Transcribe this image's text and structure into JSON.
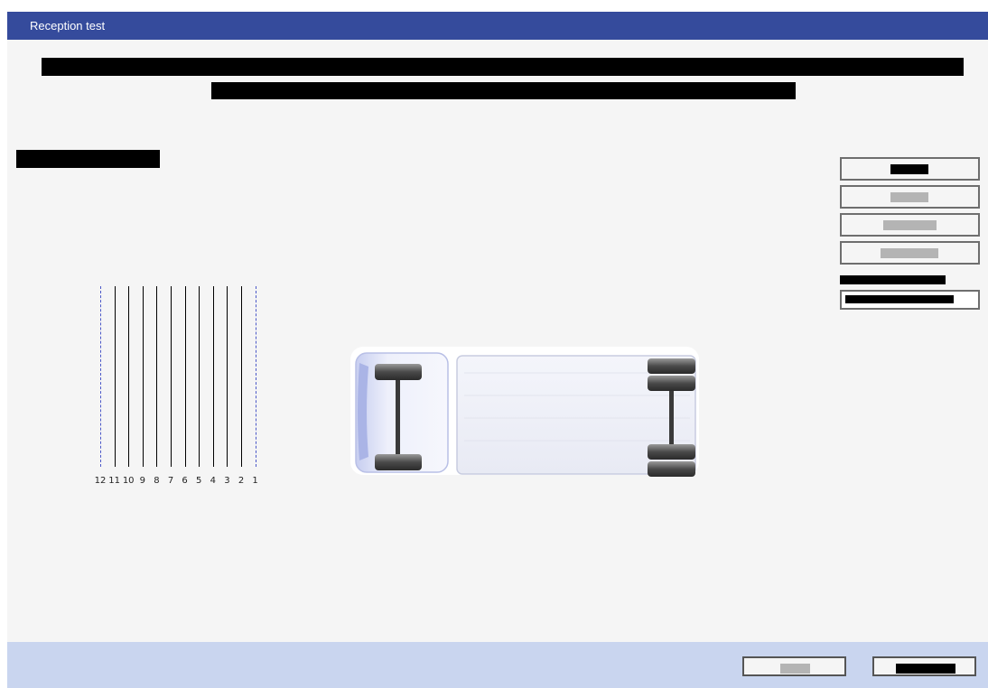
{
  "window": {
    "title": "Reception test"
  },
  "header": {
    "line1_redacted": "",
    "line2_redacted": ""
  },
  "section": {
    "label_redacted": ""
  },
  "side_panel": {
    "buttons": [
      {
        "label": "",
        "enabled": true
      },
      {
        "label": "",
        "enabled": false
      },
      {
        "label": "",
        "enabled": false
      },
      {
        "label": "",
        "enabled": false
      }
    ],
    "field_label": "",
    "field_value": ""
  },
  "lanes": {
    "numbers": [
      "12",
      "11",
      "10",
      "9",
      "8",
      "7",
      "6",
      "5",
      "4",
      "3",
      "2",
      "1"
    ]
  },
  "footer": {
    "buttons": [
      {
        "label": "",
        "enabled": false
      },
      {
        "label": "",
        "enabled": true
      }
    ]
  },
  "colors": {
    "titlebar": "#354b9c",
    "footer": "#c9d5ef",
    "background": "#f5f5f5",
    "lane_dotted": "#4b58c8"
  }
}
